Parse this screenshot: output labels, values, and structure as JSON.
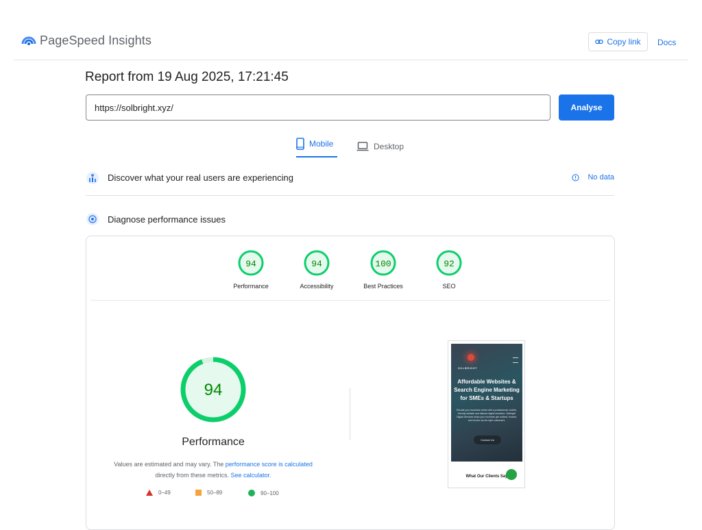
{
  "header": {
    "app_name": "PageSpeed Insights",
    "copy_link_label": "Copy link",
    "docs_label": "Docs"
  },
  "report": {
    "title": "Report from 19 Aug 2025, 17:21:45",
    "url_value": "https://solbright.xyz/",
    "analyse_label": "Analyse"
  },
  "tabs": [
    {
      "label": "Mobile",
      "selected": true,
      "icon": "smartphone-icon"
    },
    {
      "label": "Desktop",
      "selected": false,
      "icon": "laptop-icon"
    }
  ],
  "real_users": {
    "heading": "Discover what your real users are experiencing",
    "status": "No data"
  },
  "diagnose": {
    "heading": "Diagnose performance issues"
  },
  "scores": [
    {
      "label": "Performance",
      "value": "94"
    },
    {
      "label": "Accessibility",
      "value": "94"
    },
    {
      "label": "Best Practices",
      "value": "100"
    },
    {
      "label": "SEO",
      "value": "92"
    }
  ],
  "performance": {
    "score": "94",
    "title": "Performance",
    "desc_prefix": "Values are estimated and may vary. The ",
    "desc_link1": "performance score is calculated",
    "desc_middle": " directly from these metrics. ",
    "desc_link2": "See calculator."
  },
  "legend": [
    {
      "range": "0–49",
      "color": "#d93025",
      "shape": "triangle"
    },
    {
      "range": "50–89",
      "color": "#f4a33d",
      "shape": "square"
    },
    {
      "range": "90–100",
      "color": "#1fb25a",
      "shape": "circle"
    }
  ],
  "screenshot": {
    "brand": "SOLBRIGHT",
    "headline": "Affordable Websites & Search Engine Marketing for SMEs & Startups",
    "body": "Elevate your business online with a professional, mobile-friendly website and tailored digital solutions. Solbright Digital Services helps your business get noticed, trusted, and chosen by the right customers.",
    "button": "Contact Us",
    "subheading": "What Our Clients Say"
  },
  "colors": {
    "accent": "#1a73e8",
    "pass": "#0cce6b",
    "pass_text": "#008800",
    "pass_fill": "#e6f9ee"
  }
}
